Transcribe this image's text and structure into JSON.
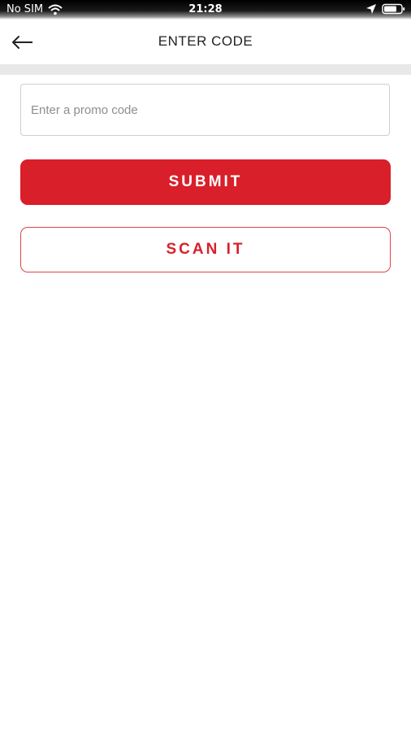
{
  "status_bar": {
    "carrier": "No SIM",
    "time": "21:28",
    "icons": [
      "wifi-icon",
      "location-icon",
      "battery-icon"
    ]
  },
  "header": {
    "back_icon": "back-arrow-icon",
    "title": "ENTER CODE"
  },
  "form": {
    "promo_input": {
      "value": "",
      "placeholder": "Enter a promo code"
    },
    "submit_label": "SUBMIT",
    "scan_label": "SCAN IT"
  },
  "colors": {
    "accent_red": "#d91f2a",
    "divider_gray": "#e8e8e8",
    "input_border": "#cfcfcf"
  }
}
